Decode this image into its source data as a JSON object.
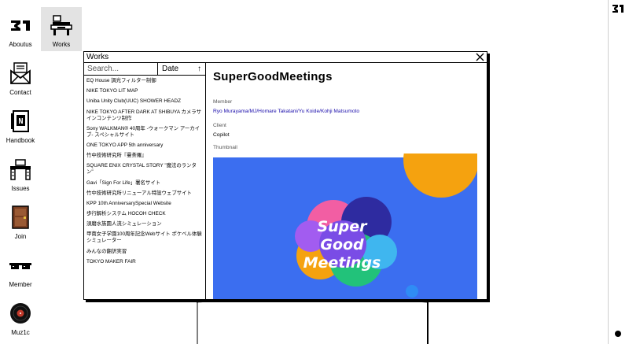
{
  "desktop": {
    "icons": [
      {
        "label": "Aboutus",
        "icon": "logo-31-icon"
      },
      {
        "label": "Works",
        "icon": "desk-computer-icon"
      },
      {
        "label": "Contact",
        "icon": "mail-envelope-icon"
      },
      {
        "label": "Handbook",
        "icon": "handbook-icon"
      },
      {
        "label": "Issues",
        "icon": "desk-issues-icon"
      },
      {
        "label": "Join",
        "icon": "door-icon"
      },
      {
        "label": "Member",
        "icon": "sunglasses-icon"
      },
      {
        "label": "Muz1c",
        "icon": "vinyl-record-icon"
      }
    ],
    "selected": "Works"
  },
  "window": {
    "title": "Works",
    "search_placeholder": "Search...",
    "sort_label": "Date",
    "sort_arrow": "↑",
    "items": [
      "EQ House 調光フィルター制御",
      "NIKE TOKYO LIT MAP",
      "Uniba Unity Club(UUC) SHOWER HEADZ",
      "NIKE TOKYO AFTER DARK AT SHIBUYA カメラサインコンテンツ制作",
      "Sony WALKMAN® 40周年 -ウォークマン アーカイブ- スペシャルサイト",
      "ONE TOKYO APP 5th anniversary",
      "竹中技術研究所『曼荼羅』",
      "SQUARE ENIX CRYSTAL STORY \"魔法のランタン\"",
      "Gavi「Sign For Life」署名サイト",
      "竹中技術研究所リニューアル特設ウェブサイト",
      "KPP 10th AnniversarySpecial Website",
      "歩行解析システム HOCOH CHECK",
      "須磨水族園人流シミュレーション",
      "甲南女子学園100周年記念Webサイト ポケベル体験シミュレーター",
      "みんなの翻訳実習",
      "TOKYO MAKER FAIR"
    ],
    "detail": {
      "title": "SuperGoodMeetings",
      "member_label": "Member",
      "members": "Ryo Murayama/MJ/Homare Takatani/Yu Koide/Kohji Matsumoto",
      "client_label": "Client",
      "client": "Copilot",
      "thumbnail_label": "Thumbnail",
      "thumbnail": {
        "line1": "Super",
        "line2": "Good",
        "line3": "Meetings",
        "bg_color": "#3b6ef0"
      }
    }
  },
  "colors": {
    "link": "#1a0dab",
    "selected_bg": "#e3e3e3",
    "thumb_blue": "#3b6ef0",
    "thumb_orange": "#f5a20f"
  }
}
